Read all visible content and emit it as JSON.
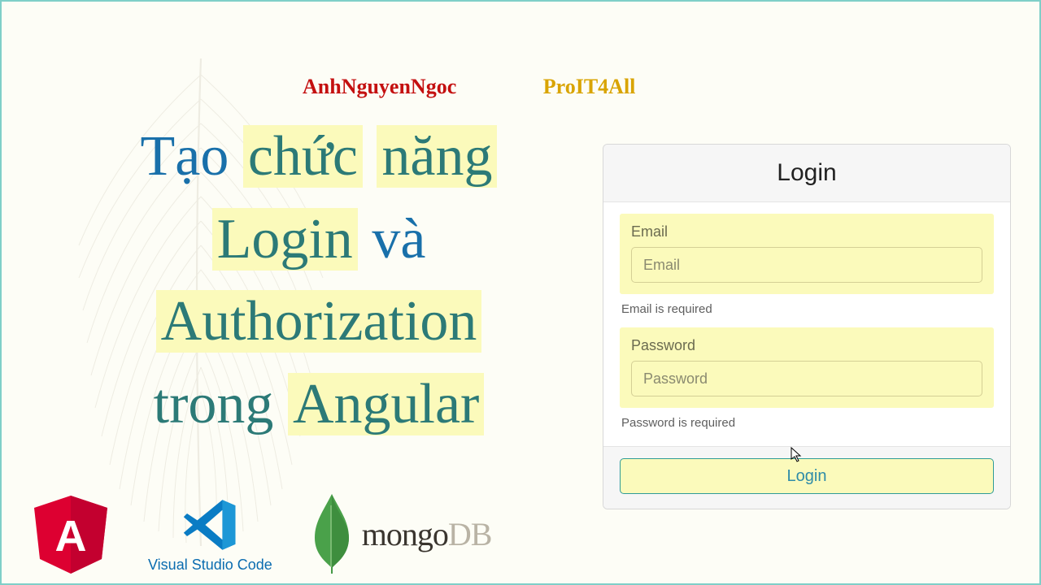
{
  "header": {
    "name1": "AnhNguyenNgoc",
    "name2": "ProIT4All"
  },
  "title": {
    "w1": "Tạo",
    "w2": "chức",
    "w3": "năng",
    "w4": "Login",
    "w5": "và",
    "w6": "Authorization",
    "w7": "trong",
    "w8": "Angular"
  },
  "login": {
    "heading": "Login",
    "email_label": "Email",
    "email_placeholder": "Email",
    "email_error": "Email is required",
    "password_label": "Password",
    "password_placeholder": "Password",
    "password_error": "Password is required",
    "button": "Login"
  },
  "logos": {
    "angular": "A",
    "vscode_label": "Visual Studio Code",
    "mongo": "mongo",
    "mongo_db": "DB"
  },
  "colors": {
    "highlight_bg": "#fbfabb",
    "teal": "#2c7a77",
    "blue": "#1970aa",
    "red": "#c41010",
    "gold": "#d9a400"
  }
}
